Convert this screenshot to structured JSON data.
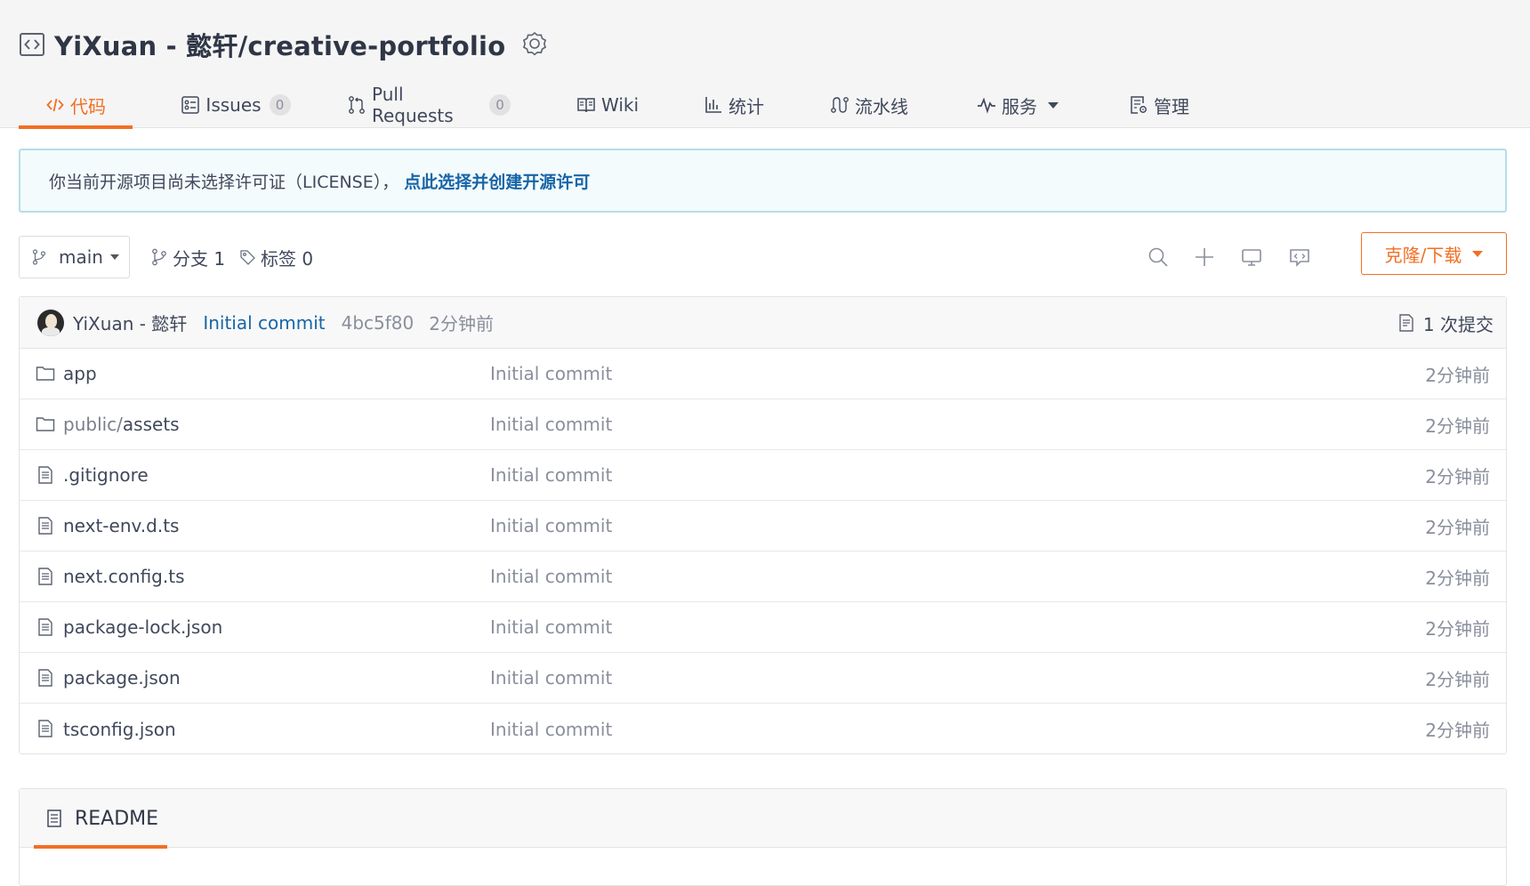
{
  "repo": {
    "title": "YiXuan - 懿轩/creative-portfolio",
    "icons": {
      "repo": "code-square-icon",
      "badge": "award-badge-icon"
    }
  },
  "tabs": [
    {
      "label": "代码",
      "icon": "code-icon",
      "active": true
    },
    {
      "label": "Issues",
      "icon": "issues-icon",
      "count": "0"
    },
    {
      "label": "Pull Requests",
      "icon": "pull-request-icon",
      "count": "0"
    },
    {
      "label": "Wiki",
      "icon": "book-icon"
    },
    {
      "label": "统计",
      "icon": "bar-chart-icon"
    },
    {
      "label": "流水线",
      "icon": "pipeline-icon"
    },
    {
      "label": "服务",
      "icon": "pulse-icon",
      "dropdown": true
    },
    {
      "label": "管理",
      "icon": "settings-doc-icon"
    }
  ],
  "notice": {
    "text": "你当前开源项目尚未选择许可证（LICENSE），",
    "link": "点此选择并创建开源许可"
  },
  "toolbar": {
    "branch": "main",
    "branches_label": "分支 1",
    "tags_label": "标签 0",
    "clone_label": "克隆/下载",
    "icons": [
      "search-icon",
      "plus-icon",
      "monitor-icon",
      "code-comment-icon"
    ]
  },
  "commit": {
    "author": "YiXuan - 懿轩",
    "message": "Initial commit",
    "sha": "4bc5f80",
    "time": "2分钟前",
    "count_label": "1 次提交"
  },
  "files": [
    {
      "type": "folder",
      "name": "app",
      "message": "Initial commit",
      "time": "2分钟前"
    },
    {
      "type": "folder",
      "name_prefix": "public/",
      "name": "assets",
      "message": "Initial commit",
      "time": "2分钟前"
    },
    {
      "type": "file",
      "name": ".gitignore",
      "message": "Initial commit",
      "time": "2分钟前"
    },
    {
      "type": "file",
      "name": "next-env.d.ts",
      "message": "Initial commit",
      "time": "2分钟前"
    },
    {
      "type": "file",
      "name": "next.config.ts",
      "message": "Initial commit",
      "time": "2分钟前"
    },
    {
      "type": "file",
      "name": "package-lock.json",
      "message": "Initial commit",
      "time": "2分钟前"
    },
    {
      "type": "file",
      "name": "package.json",
      "message": "Initial commit",
      "time": "2分钟前"
    },
    {
      "type": "file",
      "name": "tsconfig.json",
      "message": "Initial commit",
      "time": "2分钟前"
    }
  ],
  "readme": {
    "label": "README"
  },
  "colors": {
    "accent": "#f36f24",
    "link": "#1765a8",
    "notice_border": "#b6dde9"
  }
}
